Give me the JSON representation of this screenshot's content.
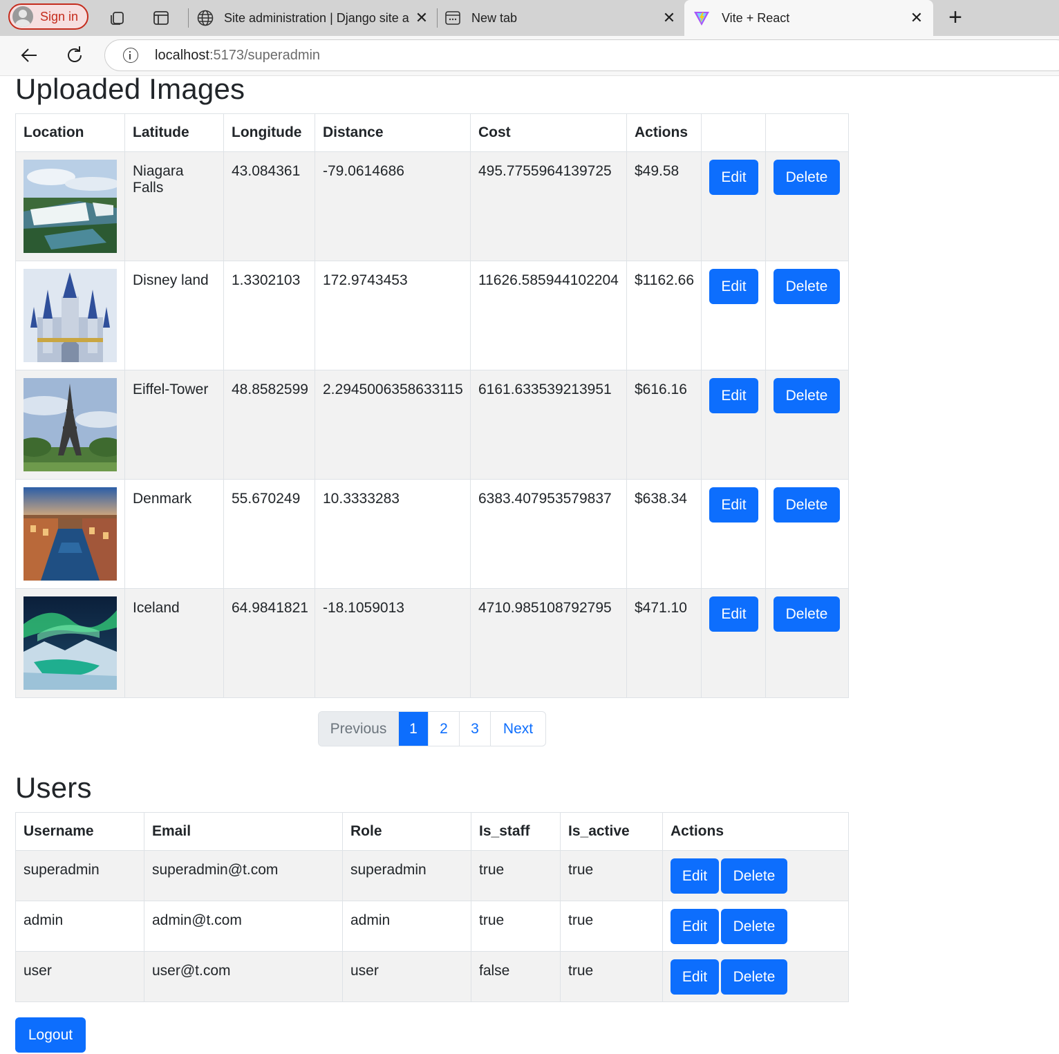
{
  "browser": {
    "signin_label": "Sign in",
    "tabs": [
      {
        "title": "Site administration | Django site a",
        "icon": "globe-icon"
      },
      {
        "title": "New tab",
        "icon": "new-tab-icon"
      },
      {
        "title": "Vite + React",
        "icon": "vite-logo-icon"
      }
    ],
    "url_host": "localhost",
    "url_rest": ":5173/superadmin"
  },
  "images_section": {
    "title": "Uploaded Images",
    "headers": [
      "Location",
      "Latitude",
      "Longitude",
      "Distance",
      "Cost",
      "Actions"
    ],
    "rows": [
      {
        "image": "niagara-falls-photo",
        "location": "Niagara Falls",
        "latitude": "43.084361",
        "longitude": "-79.0614686",
        "distance": "495.7755964139725",
        "cost": "$49.58"
      },
      {
        "image": "disney-castle-photo",
        "location": "Disney land",
        "latitude": "1.3302103",
        "longitude": "172.9743453",
        "distance": "11626.585944102204",
        "cost": "$1162.66"
      },
      {
        "image": "eiffel-tower-photo",
        "location": "Eiffel-Tower",
        "latitude": "48.8582599",
        "longitude": "2.2945006358633115",
        "distance": "6161.633539213951",
        "cost": "$616.16"
      },
      {
        "image": "copenhagen-canal-photo",
        "location": "Denmark",
        "latitude": "55.670249",
        "longitude": "10.3333283",
        "distance": "6383.407953579837",
        "cost": "$638.34"
      },
      {
        "image": "aurora-iceland-photo",
        "location": "Iceland",
        "latitude": "64.9841821",
        "longitude": "-18.1059013",
        "distance": "4710.985108792795",
        "cost": "$471.10"
      }
    ],
    "edit_label": "Edit",
    "delete_label": "Delete"
  },
  "pagination": {
    "previous": "Previous",
    "pages": [
      "1",
      "2",
      "3"
    ],
    "current": "1",
    "next": "Next"
  },
  "users_section": {
    "title": "Users",
    "headers": [
      "Username",
      "Email",
      "Role",
      "Is_staff",
      "Is_active",
      "Actions"
    ],
    "rows": [
      {
        "username": "superadmin",
        "email": "superadmin@t.com",
        "role": "superadmin",
        "is_staff": "true",
        "is_active": "true"
      },
      {
        "username": "admin",
        "email": "admin@t.com",
        "role": "admin",
        "is_staff": "true",
        "is_active": "true"
      },
      {
        "username": "user",
        "email": "user@t.com",
        "role": "user",
        "is_staff": "false",
        "is_active": "true"
      }
    ],
    "edit_label": "Edit",
    "delete_label": "Delete"
  },
  "logout_label": "Logout",
  "colors": {
    "primary": "#0d6efd",
    "stripe": "#f2f2f2",
    "border": "#dee2e6"
  }
}
